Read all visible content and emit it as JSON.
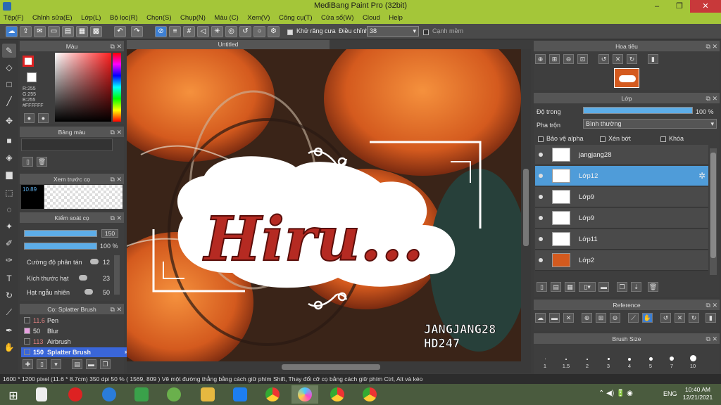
{
  "window": {
    "title": "MediBang Paint Pro (32bit)",
    "min": "–",
    "max": "❐",
    "close": "✕"
  },
  "menu": [
    "Tệp(F)",
    "Chỉnh sửa(E)",
    "Lớp(L)",
    "Bộ lọc(R)",
    "Chọn(S)",
    "Chụp(N)",
    "Màu (C)",
    "Xem(V)",
    "Công cụ(T)",
    "Cửa sổ(W)",
    "Cloud",
    "Help"
  ],
  "toolbar": {
    "antialias_label": "Khử răng cưa",
    "adjust_label": "Điều chỉnh",
    "adjust_value": "38",
    "edge_label": "Cạnh mềm"
  },
  "panels": {
    "color": {
      "title": "Màu",
      "r": "R:255",
      "g": "G:255",
      "b": "B:255",
      "hex": "#FFFFFF"
    },
    "palette": {
      "title": "Bảng màu"
    },
    "brush_preview": {
      "title": "Xem trước cọ",
      "size": "10.89"
    },
    "brush_control": {
      "title": "Kiểm soát cọ",
      "size_value": "150",
      "opacity_value": "100 %",
      "resolution_label": "Cường độ phân tán",
      "resolution_value": "12",
      "grain_label": "Kích thước hạt",
      "grain_value": "23",
      "random_label": "Hạt ngẫu nhiên",
      "random_value": "50"
    },
    "brush_list": {
      "title": "Cọ: Splatter Brush",
      "items": [
        {
          "size": "11.6",
          "name": "Pen",
          "color": "#2a2a2a"
        },
        {
          "size": "50",
          "name": "Blur",
          "color": "#e8a0e0"
        },
        {
          "size": "113",
          "name": "Airbrush",
          "color": "#2a2a2a"
        },
        {
          "size": "150",
          "name": "Splatter Brush",
          "color": "#3a66d9"
        }
      ]
    },
    "navigator": {
      "title": "Hoa tiêu"
    },
    "layer": {
      "title": "Lớp",
      "opacity_label": "Độ trong",
      "opacity_value": "100 %",
      "blend_label": "Pha trộn",
      "blend_value": "Bình thường",
      "protect_alpha": "Bảo vệ alpha",
      "clipping": "Xén bớt",
      "lock": "Khóa",
      "layers": [
        {
          "name": "jangjang28",
          "selected": false
        },
        {
          "name": "Lớp12",
          "selected": true
        },
        {
          "name": "Lớp9",
          "selected": false
        },
        {
          "name": "Lớp9",
          "selected": false
        },
        {
          "name": "Lớp11",
          "selected": false
        },
        {
          "name": "Lớp2",
          "selected": false
        }
      ]
    },
    "reference": {
      "title": "Reference"
    },
    "brush_size": {
      "title": "Brush Size",
      "sizes": [
        "1",
        "1.5",
        "2",
        "3",
        "4",
        "5",
        "7",
        "10"
      ]
    }
  },
  "canvas": {
    "tab": "Untitled",
    "art_text": "Hiru...",
    "sig_line1": "JANGJANG28",
    "sig_line2": "HD247"
  },
  "status": {
    "text": "1600 * 1200 pixel   (11.6 * 8.7cm)   350 dpi   50 %   ( 1569, 809 )   Vẽ một đường thẳng bằng cách giữ phím Shift, Thay đổi cỡ cọ bằng cách giữ phím Ctrl, Alt và kéo"
  },
  "taskbar": {
    "lang": "ENG",
    "time": "10:40 AM",
    "date": "12/21/2021",
    "apps": [
      "windows-start",
      "file",
      "opera",
      "edge",
      "store",
      "app-green",
      "explorer",
      "zalo",
      "chrome",
      "medibang",
      "chrome-n",
      "chrome-alt"
    ]
  },
  "colors": {
    "accent": "#4f9cd9",
    "titlebar": "#a4c639"
  }
}
